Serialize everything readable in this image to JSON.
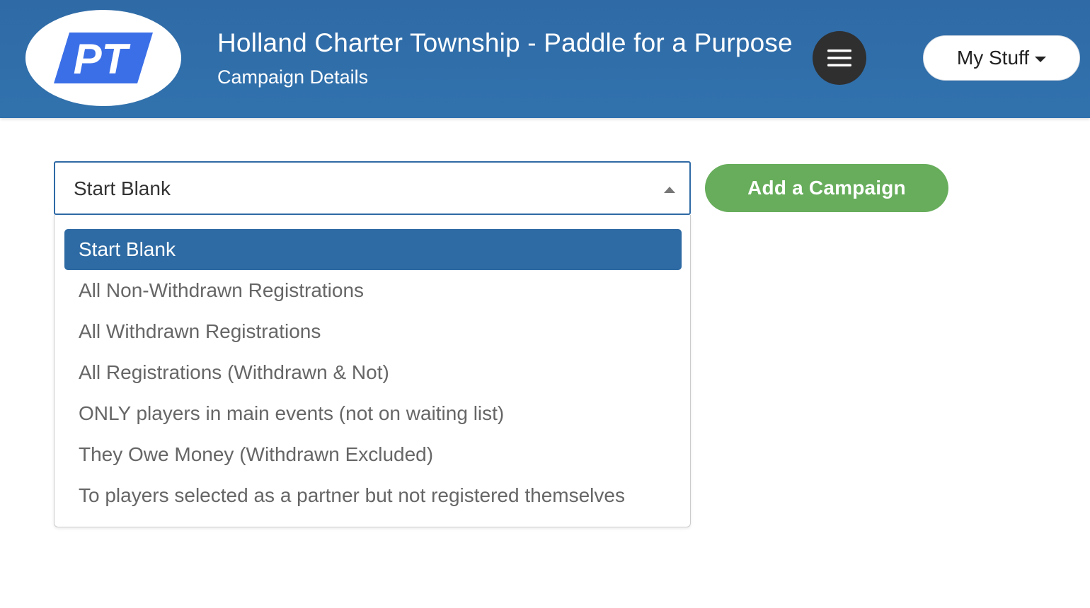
{
  "header": {
    "logo_text": "PT",
    "title": "Holland Charter Township - Paddle for a Purpose",
    "subtitle": "Campaign Details",
    "menu_icon": "hamburger-icon",
    "my_stuff_label": "My Stuff"
  },
  "colors": {
    "header_bg": "#2f6aa6",
    "logo_blue": "#3b6fe8",
    "menu_button_bg": "#2f2f2f",
    "active_option_bg": "#2e6aa3",
    "add_button_bg": "#67ad5b"
  },
  "campaign_select": {
    "selected": "Start Blank",
    "options": [
      "Start Blank",
      "All Non-Withdrawn Registrations",
      "All Withdrawn Registrations",
      "All Registrations (Withdrawn & Not)",
      "ONLY players in main events (not on waiting list)",
      "They Owe Money (Withdrawn Excluded)",
      "To players selected as a partner but not registered themselves"
    ]
  },
  "add_campaign_label": "Add a Campaign"
}
